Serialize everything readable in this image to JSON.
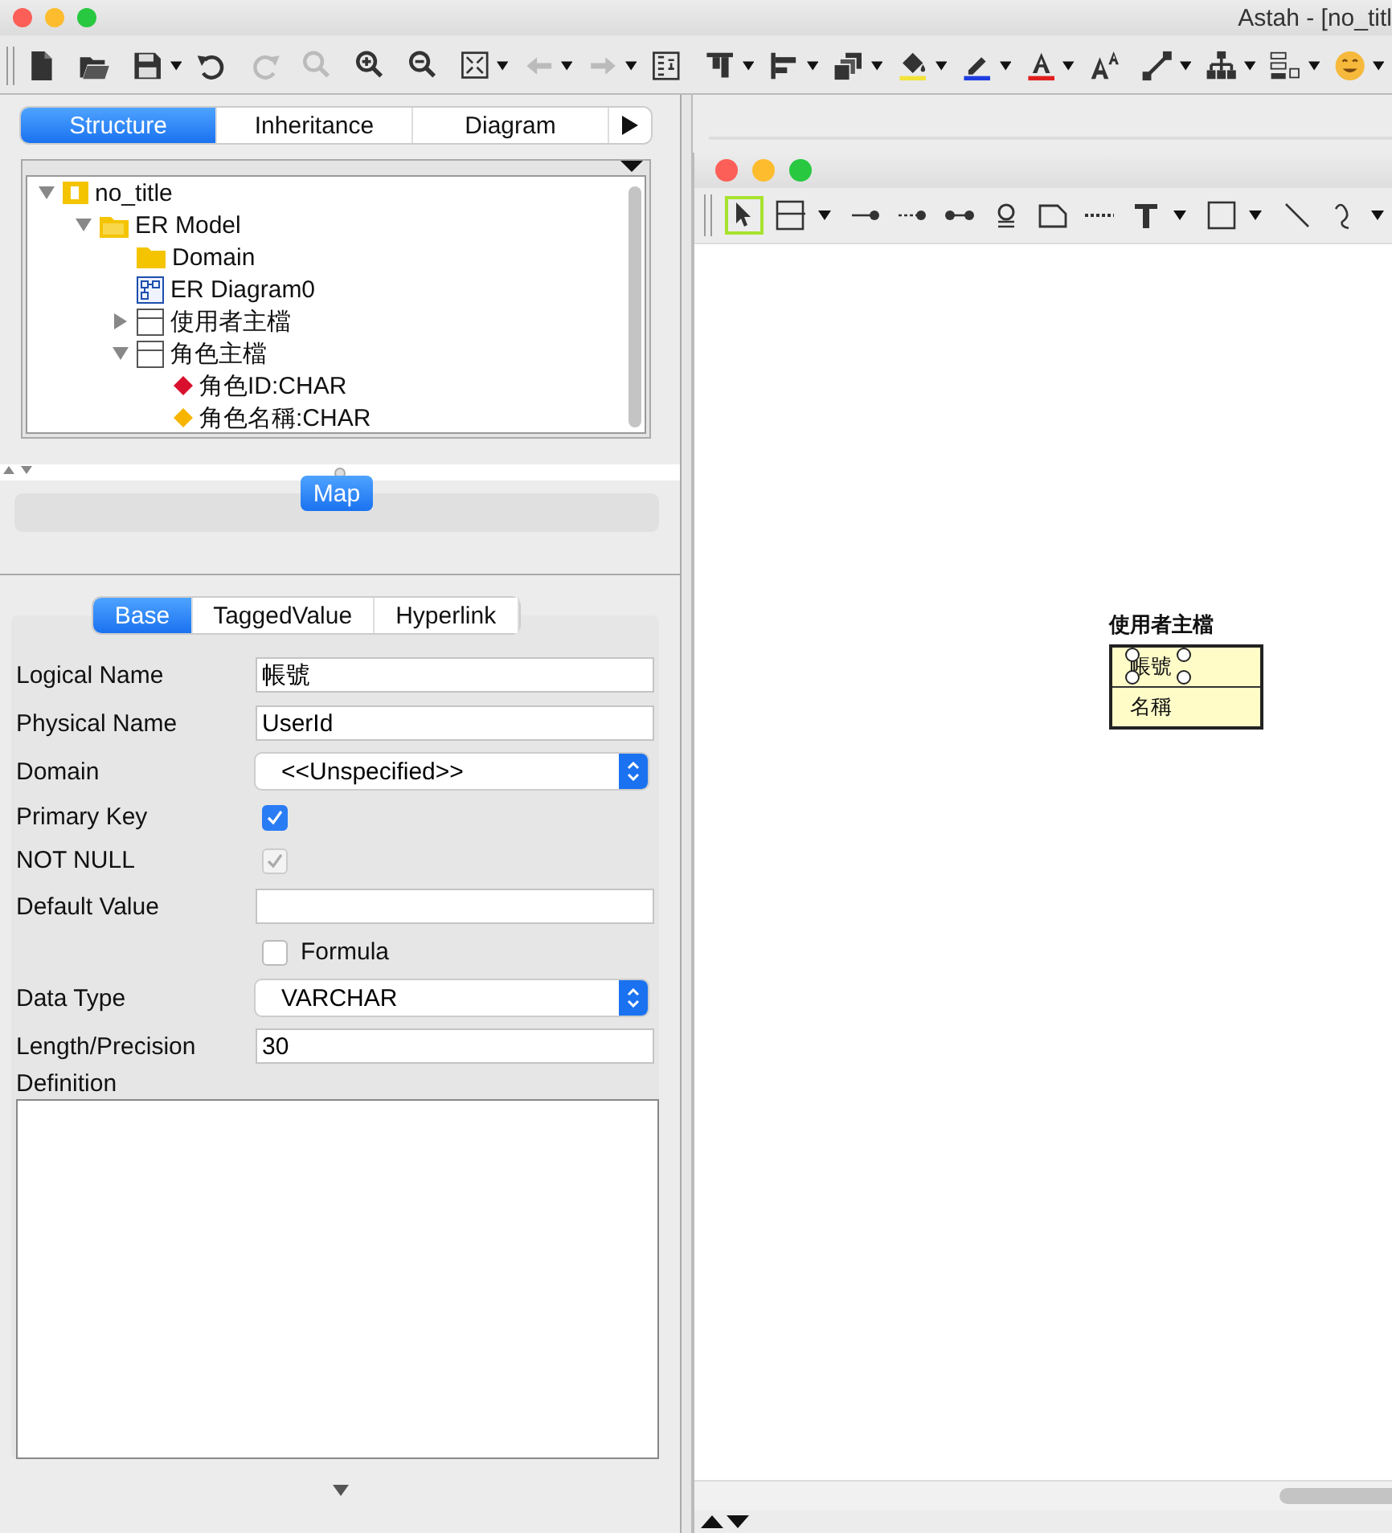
{
  "window": {
    "title": "Astah - [no_titl"
  },
  "explorer_tabs": [
    {
      "label": "Structure",
      "selected": true
    },
    {
      "label": "Inheritance",
      "selected": false
    },
    {
      "label": "Diagram",
      "selected": false
    }
  ],
  "tree": [
    {
      "label": "no_title",
      "kind": "project",
      "expanded": true,
      "children": [
        {
          "label": "ER Model",
          "kind": "model",
          "expanded": true,
          "children": [
            {
              "label": "Domain",
              "kind": "folder"
            },
            {
              "label": "ER Diagram0",
              "kind": "diagram"
            },
            {
              "label": "使用者主檔",
              "kind": "entity",
              "expanded": false
            },
            {
              "label": "角色主檔",
              "kind": "entity",
              "expanded": true,
              "children": [
                {
                  "label": "角色ID:CHAR",
                  "kind": "primary_key"
                },
                {
                  "label": "角色名稱:CHAR",
                  "kind": "attribute"
                }
              ]
            }
          ]
        }
      ]
    }
  ],
  "map": {
    "button": "Map"
  },
  "property_tabs": [
    {
      "label": "Base",
      "selected": true
    },
    {
      "label": "TaggedValue",
      "selected": false
    },
    {
      "label": "Hyperlink",
      "selected": false
    }
  ],
  "properties": [
    {
      "kind": "text",
      "label": "Logical Name",
      "value": "帳號"
    },
    {
      "kind": "text",
      "label": "Physical Name",
      "value": "UserId"
    },
    {
      "kind": "select",
      "label": "Domain",
      "value": "<<Unspecified>>"
    },
    {
      "kind": "checkbox",
      "label": "Primary Key",
      "checked": true,
      "disabled": false
    },
    {
      "kind": "checkbox",
      "label": "NOT NULL",
      "checked": true,
      "disabled": true
    },
    {
      "kind": "text",
      "label": "Default Value"
    },
    {
      "kind": "checkbox",
      "text": "Formula",
      "checked": false
    },
    {
      "kind": "select",
      "label": "Data Type",
      "value": "VARCHAR"
    },
    {
      "kind": "text",
      "label": "Length/Precision",
      "value": "30"
    },
    {
      "kind": "textarea",
      "label": "Definition"
    }
  ],
  "palette": [
    {
      "kind": "select",
      "selected": true
    },
    {
      "kind": "entity",
      "selected": false
    },
    {
      "kind": "relation",
      "selected": false
    },
    {
      "kind": "dashed_relation",
      "selected": false
    },
    {
      "kind": "many_relation",
      "selected": false
    },
    {
      "kind": "stamp",
      "selected": false
    },
    {
      "kind": "note",
      "selected": false
    },
    {
      "kind": "dotted_line",
      "selected": false
    },
    {
      "kind": "text",
      "selected": false
    },
    {
      "kind": "rectangle",
      "selected": false
    },
    {
      "kind": "line",
      "selected": false
    },
    {
      "kind": "freehand",
      "selected": false
    }
  ],
  "diagram": {
    "entity": {
      "title": "使用者主檔",
      "attributes": [
        {
          "name": "帳號",
          "selected": true
        },
        {
          "name": "名稱",
          "selected": false
        }
      ]
    }
  }
}
